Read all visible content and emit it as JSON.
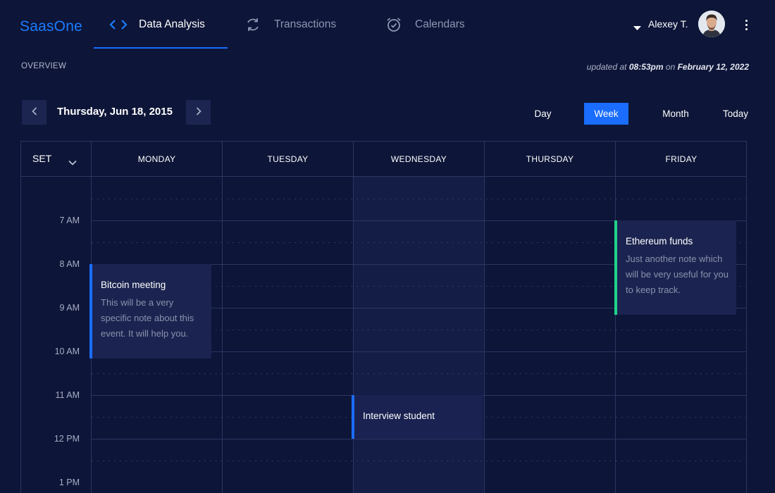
{
  "brand": "SaasOne",
  "nav": {
    "tabs": [
      {
        "label": "Data Analysis",
        "icon": "code-brackets-icon",
        "active": true
      },
      {
        "label": "Transactions",
        "icon": "refresh-icon",
        "active": false
      },
      {
        "label": "Calendars",
        "icon": "alarm-clock-icon",
        "active": false
      }
    ]
  },
  "user": {
    "name": "Alexey T.",
    "avatar": "user-avatar"
  },
  "overview": {
    "label": "OVERVIEW",
    "updated_prefix": "updated at",
    "updated_time": "08:53pm",
    "updated_on": "on",
    "updated_date": "February 12, 2022"
  },
  "date_nav": {
    "current": "Thursday, Jun 18, 2015"
  },
  "views": {
    "day": "Day",
    "week": "Week",
    "month": "Month",
    "today": "Today",
    "selected": "Week"
  },
  "calendar": {
    "set_label": "SET",
    "days": [
      "MONDAY",
      "TUESDAY",
      "WEDNESDAY",
      "THURSDAY",
      "FRIDAY"
    ],
    "hours": [
      "7 AM",
      "8 AM",
      "9 AM",
      "10 AM",
      "11 AM",
      "12 PM",
      "1 PM"
    ],
    "events": {
      "bitcoin": {
        "title": "Bitcoin meeting",
        "note": "This will be a very specific note about this event. It will help you.",
        "day": "MONDAY",
        "start": "8 AM",
        "end": "10:10 AM",
        "color": "#1a6dff"
      },
      "interview": {
        "title": "Interview student",
        "note": "",
        "day": "WEDNESDAY",
        "start": "11 AM",
        "end": "12 PM",
        "color": "#1a6dff"
      },
      "ethereum": {
        "title": "Ethereum funds",
        "note": "Just another note which will be very useful for you to keep track.",
        "day": "FRIDAY",
        "start": "7 AM",
        "end": "9:10 AM",
        "color": "#1ed38a"
      }
    }
  },
  "colors": {
    "background": "#0d1538",
    "accent": "#1a6dff",
    "brand": "#1a7cff",
    "green_event": "#1ed38a",
    "grid": "#2c3661"
  }
}
